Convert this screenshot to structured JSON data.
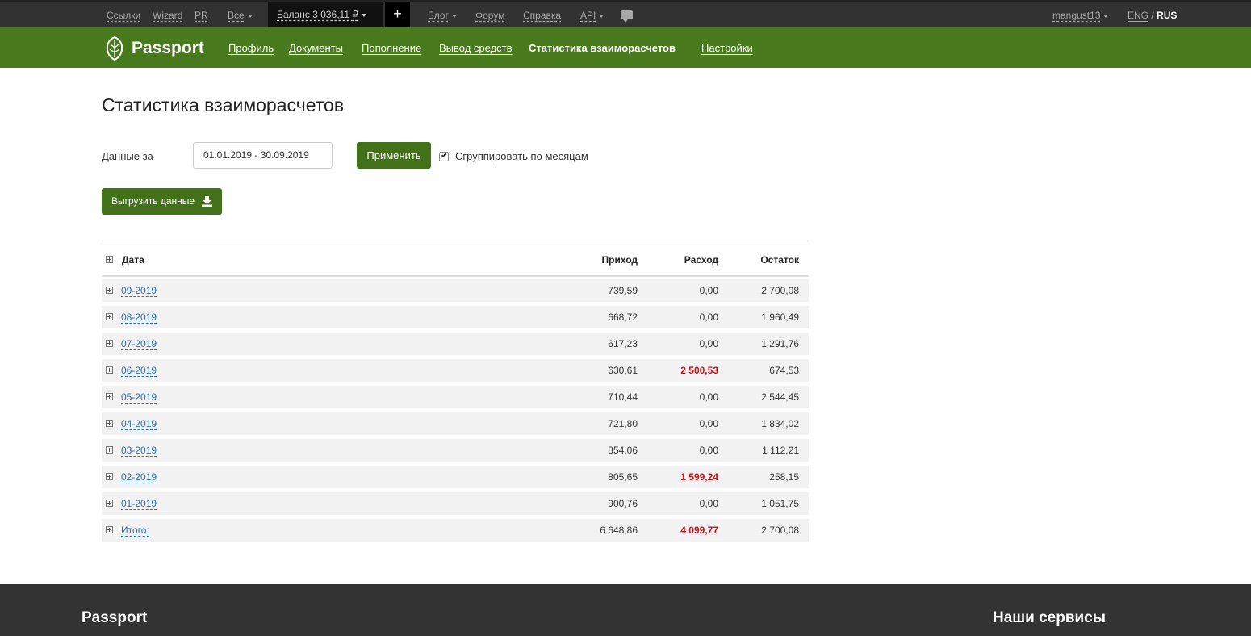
{
  "topbar": {
    "links": [
      "Ссылки",
      "Wizard",
      "PR"
    ],
    "all_label": "Все",
    "balance_label": "Баланс  3 036,11 ₽",
    "plus": "+",
    "blog": "Блог",
    "forum": "Форум",
    "help": "Справка",
    "api": "API",
    "user": "mangust13",
    "lang_eng": "ENG",
    "lang_sep": " / ",
    "lang_rus": "RUS"
  },
  "nav": {
    "logo": "Passport",
    "items": [
      "Профиль",
      "Документы",
      "Пополнение",
      "Вывод средств",
      "Статистика взаиморасчетов",
      "Настройки"
    ]
  },
  "page": {
    "title": "Статистика взаиморасчетов",
    "filter_label": "Данные за",
    "date_range": "01.01.2019 - 30.09.2019",
    "apply": "Применить",
    "group_by_month": "Сгруппировать по месяцам",
    "group_checked": true,
    "export": "Выгрузить данные"
  },
  "table": {
    "headers": {
      "date": "Дата",
      "income": "Приход",
      "expense": "Расход",
      "balance": "Остаток"
    },
    "rows": [
      {
        "date": "09-2019",
        "income": "739,59",
        "expense": "0,00",
        "balance": "2 700,08"
      },
      {
        "date": "08-2019",
        "income": "668,72",
        "expense": "0,00",
        "balance": "1 960,49"
      },
      {
        "date": "07-2019",
        "income": "617,23",
        "expense": "0,00",
        "balance": "1 291,76"
      },
      {
        "date": "06-2019",
        "income": "630,61",
        "expense": "2 500,53",
        "balance": "674,53"
      },
      {
        "date": "05-2019",
        "income": "710,44",
        "expense": "0,00",
        "balance": "2 544,45"
      },
      {
        "date": "04-2019",
        "income": "721,80",
        "expense": "0,00",
        "balance": "1 834,02"
      },
      {
        "date": "03-2019",
        "income": "854,06",
        "expense": "0,00",
        "balance": "1 112,21"
      },
      {
        "date": "02-2019",
        "income": "805,65",
        "expense": "1 599,24",
        "balance": "258,15"
      },
      {
        "date": "01-2019",
        "income": "900,76",
        "expense": "0,00",
        "balance": "1 051,75"
      },
      {
        "date": "Итого:",
        "income": "6 648,86",
        "expense": "4 099,77",
        "balance": "2 700,08"
      }
    ]
  },
  "footer": {
    "title": "Passport",
    "services": "Наши сервисы"
  },
  "colors": {
    "topbar": "#323232",
    "nav_green": "#4a7a1e",
    "button_green": "#42711a",
    "expense_red": "#c8111a",
    "link_blue": "#2a6fb0"
  }
}
